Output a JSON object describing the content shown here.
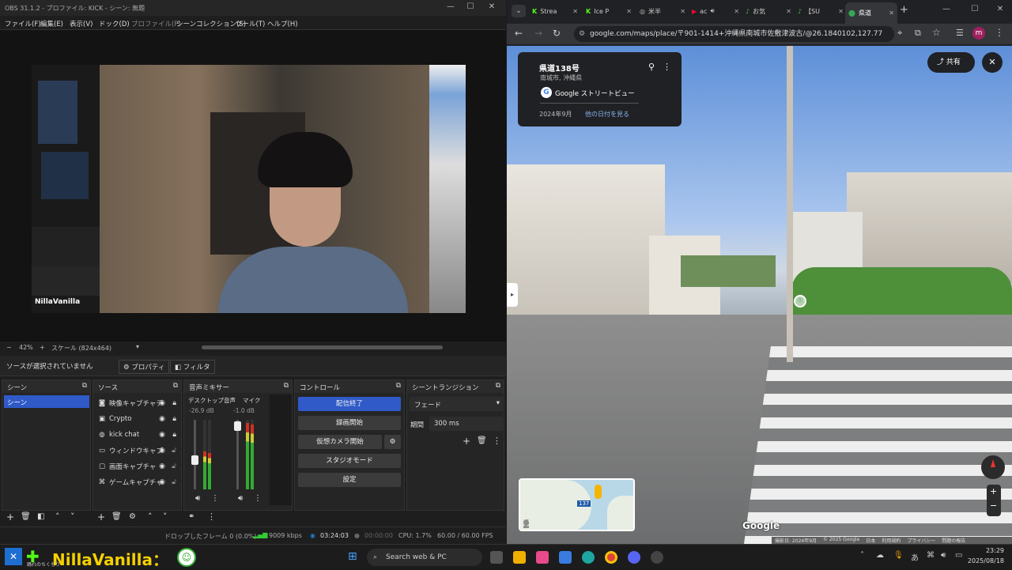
{
  "obs": {
    "title": "OBS 31.1.2 - プロファイル: KICK - シーン: 無題",
    "menu": [
      "ファイル(F)",
      "編集(E)",
      "表示(V)",
      "ドック(D)",
      "プロファイル(P)",
      "シーンコレクション(S)",
      "ツール(T)",
      "ヘルプ(H)"
    ],
    "preview": {
      "overlay_name": "NillaVanilla",
      "zoom_label": "42%",
      "scale_label": "スケール (824x464)"
    },
    "source_bar": {
      "no_source": "ソースが選択されていません",
      "properties": "プロパティ",
      "filters": "フィルタ"
    },
    "scenes": {
      "title": "シーン",
      "items": [
        "シーン"
      ]
    },
    "sources": {
      "title": "ソース",
      "items": [
        {
          "label": "映像キャプチャデ",
          "icon": "camera-icon"
        },
        {
          "label": "Crypto",
          "icon": "browser-icon"
        },
        {
          "label": "kick chat",
          "icon": "globe-icon"
        },
        {
          "label": "ウィンドウキャプ",
          "icon": "window-icon"
        },
        {
          "label": "画面キャプチャ",
          "icon": "monitor-icon"
        },
        {
          "label": "ゲームキャプチャ",
          "icon": "gamepad-icon"
        }
      ]
    },
    "mixer": {
      "title": "音声ミキサー",
      "channels": [
        {
          "name": "デスクトップ音声",
          "db": "-26.9 dB",
          "level": 0.45
        },
        {
          "name": "マイク",
          "db": "-1.0 dB",
          "level": 0.85
        }
      ],
      "scale": [
        "0",
        "-5",
        "-10",
        "-15",
        "-20",
        "-25",
        "-30",
        "-35",
        "-40",
        "-45",
        "-50",
        "-55",
        "-60"
      ]
    },
    "controls": {
      "title": "コントロール",
      "stop_stream": "配信終了",
      "start_record": "録画開始",
      "virtual_cam": "仮想カメラ開始",
      "studio_mode": "スタジオモード",
      "settings": "設定"
    },
    "transitions": {
      "title": "シーントランジション",
      "type": "フェード",
      "duration_label": "期間",
      "duration": "300 ms"
    },
    "status": {
      "dropped": "ドロップしたフレーム 0 (0.0%)",
      "kbps": "9009 kbps",
      "stream_time": "03:24:03",
      "rec_time": "00:00:00",
      "cpu": "CPU: 1.7%",
      "fps": "60.00 / 60.00 FPS"
    }
  },
  "chrome": {
    "tabs": [
      {
        "label": "Strea",
        "icon": "kick-icon",
        "color": "#53fc18"
      },
      {
        "label": "Ice P",
        "icon": "kick-icon",
        "color": "#53fc18"
      },
      {
        "label": "米半",
        "icon": "web-icon",
        "color": "#999999"
      },
      {
        "label": "ac",
        "icon": "youtube-icon",
        "color": "#ff0033"
      },
      {
        "label": "お気",
        "icon": "suumo-icon",
        "color": "#4caf50"
      },
      {
        "label": "【SU",
        "icon": "suumo-icon",
        "color": "#4caf50"
      },
      {
        "label": "県道",
        "icon": "maps-icon",
        "color": "#34a853",
        "active": true
      }
    ],
    "url": "google.com/maps/place/〒901-1414+沖縄県南城市佐敷津波古/@26.1840102,127.774859,...",
    "profile_initial": "m",
    "street_view": {
      "road_name": "県道138号",
      "location": "南城市, 沖縄県",
      "provider": "Google ストリートビュー",
      "date": "2024年9月",
      "other_dates": "他の日付を見る",
      "share_label": "共有",
      "google_logo": "Google",
      "footer": [
        "撮影日: 2024年9月",
        "© 2025 Google",
        "日本",
        "利用規約",
        "プライバシー",
        "問題の報告"
      ],
      "minimap_route": "137"
    }
  },
  "taskbar": {
    "search_placeholder": "Search web & PC",
    "time": "23:29",
    "date": "2025/08/18",
    "ime": "あ",
    "overlay_name": "NillaVanilla：",
    "overlay_sub": "踊れのちくもり"
  }
}
